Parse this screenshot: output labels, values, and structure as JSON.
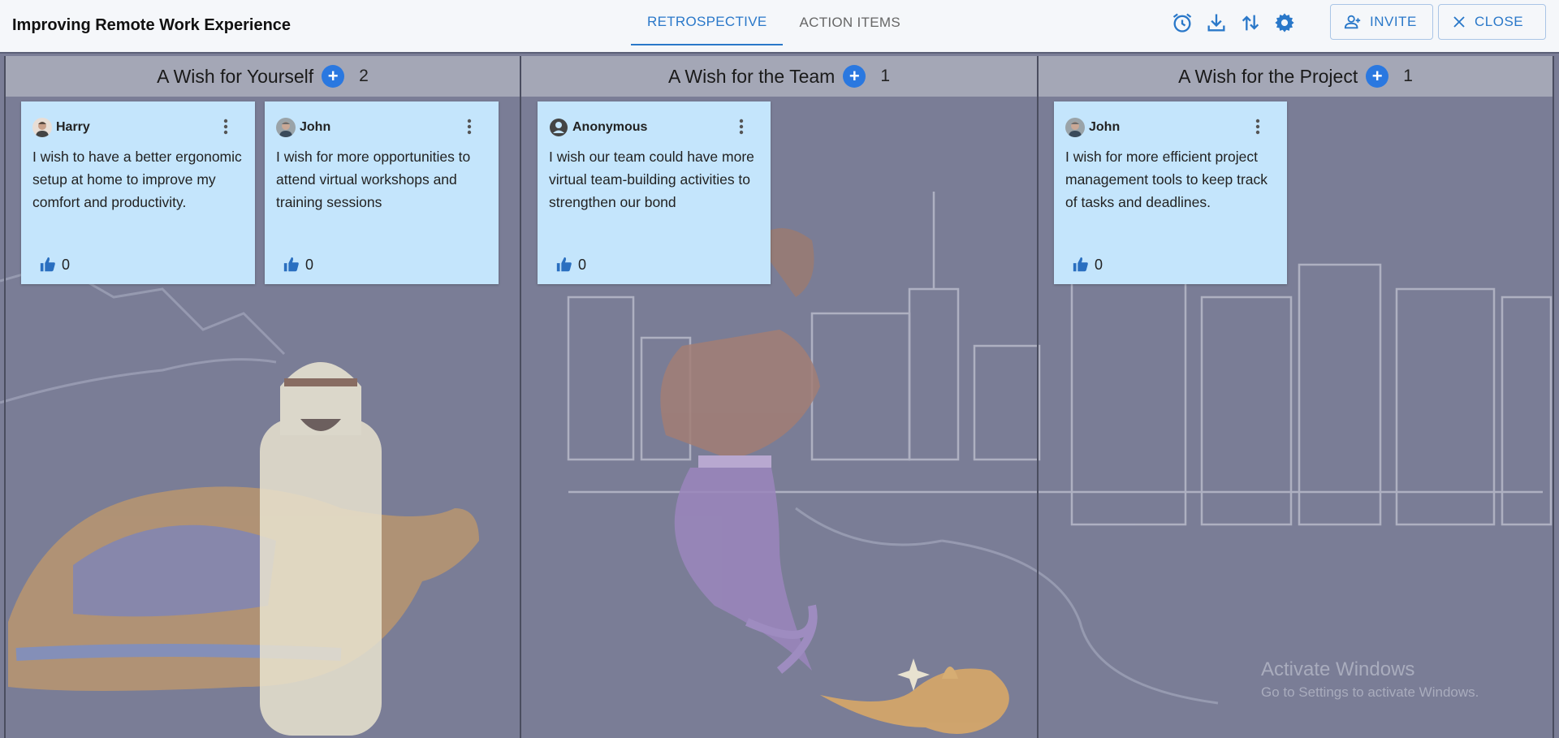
{
  "header": {
    "title": "Improving Remote Work Experience",
    "tabs": [
      {
        "label": "RETROSPECTIVE",
        "active": true
      },
      {
        "label": "ACTION ITEMS",
        "active": false
      }
    ],
    "icons": [
      "alarm-icon",
      "download-icon",
      "sort-icon",
      "gear-icon"
    ],
    "invite_label": "INVITE",
    "close_label": "CLOSE",
    "accent_color": "#2a78c9"
  },
  "columns": [
    {
      "title": "A Wish for Yourself",
      "count": "2"
    },
    {
      "title": "A Wish for the Team",
      "count": "1"
    },
    {
      "title": "A Wish for the Project",
      "count": "1"
    }
  ],
  "cards": [
    {
      "author": "Harry",
      "text": "I wish to have a better ergonomic setup at home to improve my comfort and productivity.",
      "likes": "0"
    },
    {
      "author": "John",
      "text": "I wish for more opportunities to attend virtual workshops and training sessions",
      "likes": "0"
    },
    {
      "author": "Anonymous",
      "text": "I wish our team could have more virtual team-building activities to strengthen our bond",
      "likes": "0"
    },
    {
      "author": "John",
      "text": "I wish for more efficient project management tools to keep track of tasks and deadlines.",
      "likes": "0"
    }
  ],
  "watermark": {
    "line1": "Activate Windows",
    "line2": "Go to Settings to activate Windows."
  },
  "colors": {
    "card_bg": "#c4e5fc",
    "column_header": "#a4a7b6",
    "board_bg": "#7a7d96",
    "plus_button": "#2a78e0"
  }
}
